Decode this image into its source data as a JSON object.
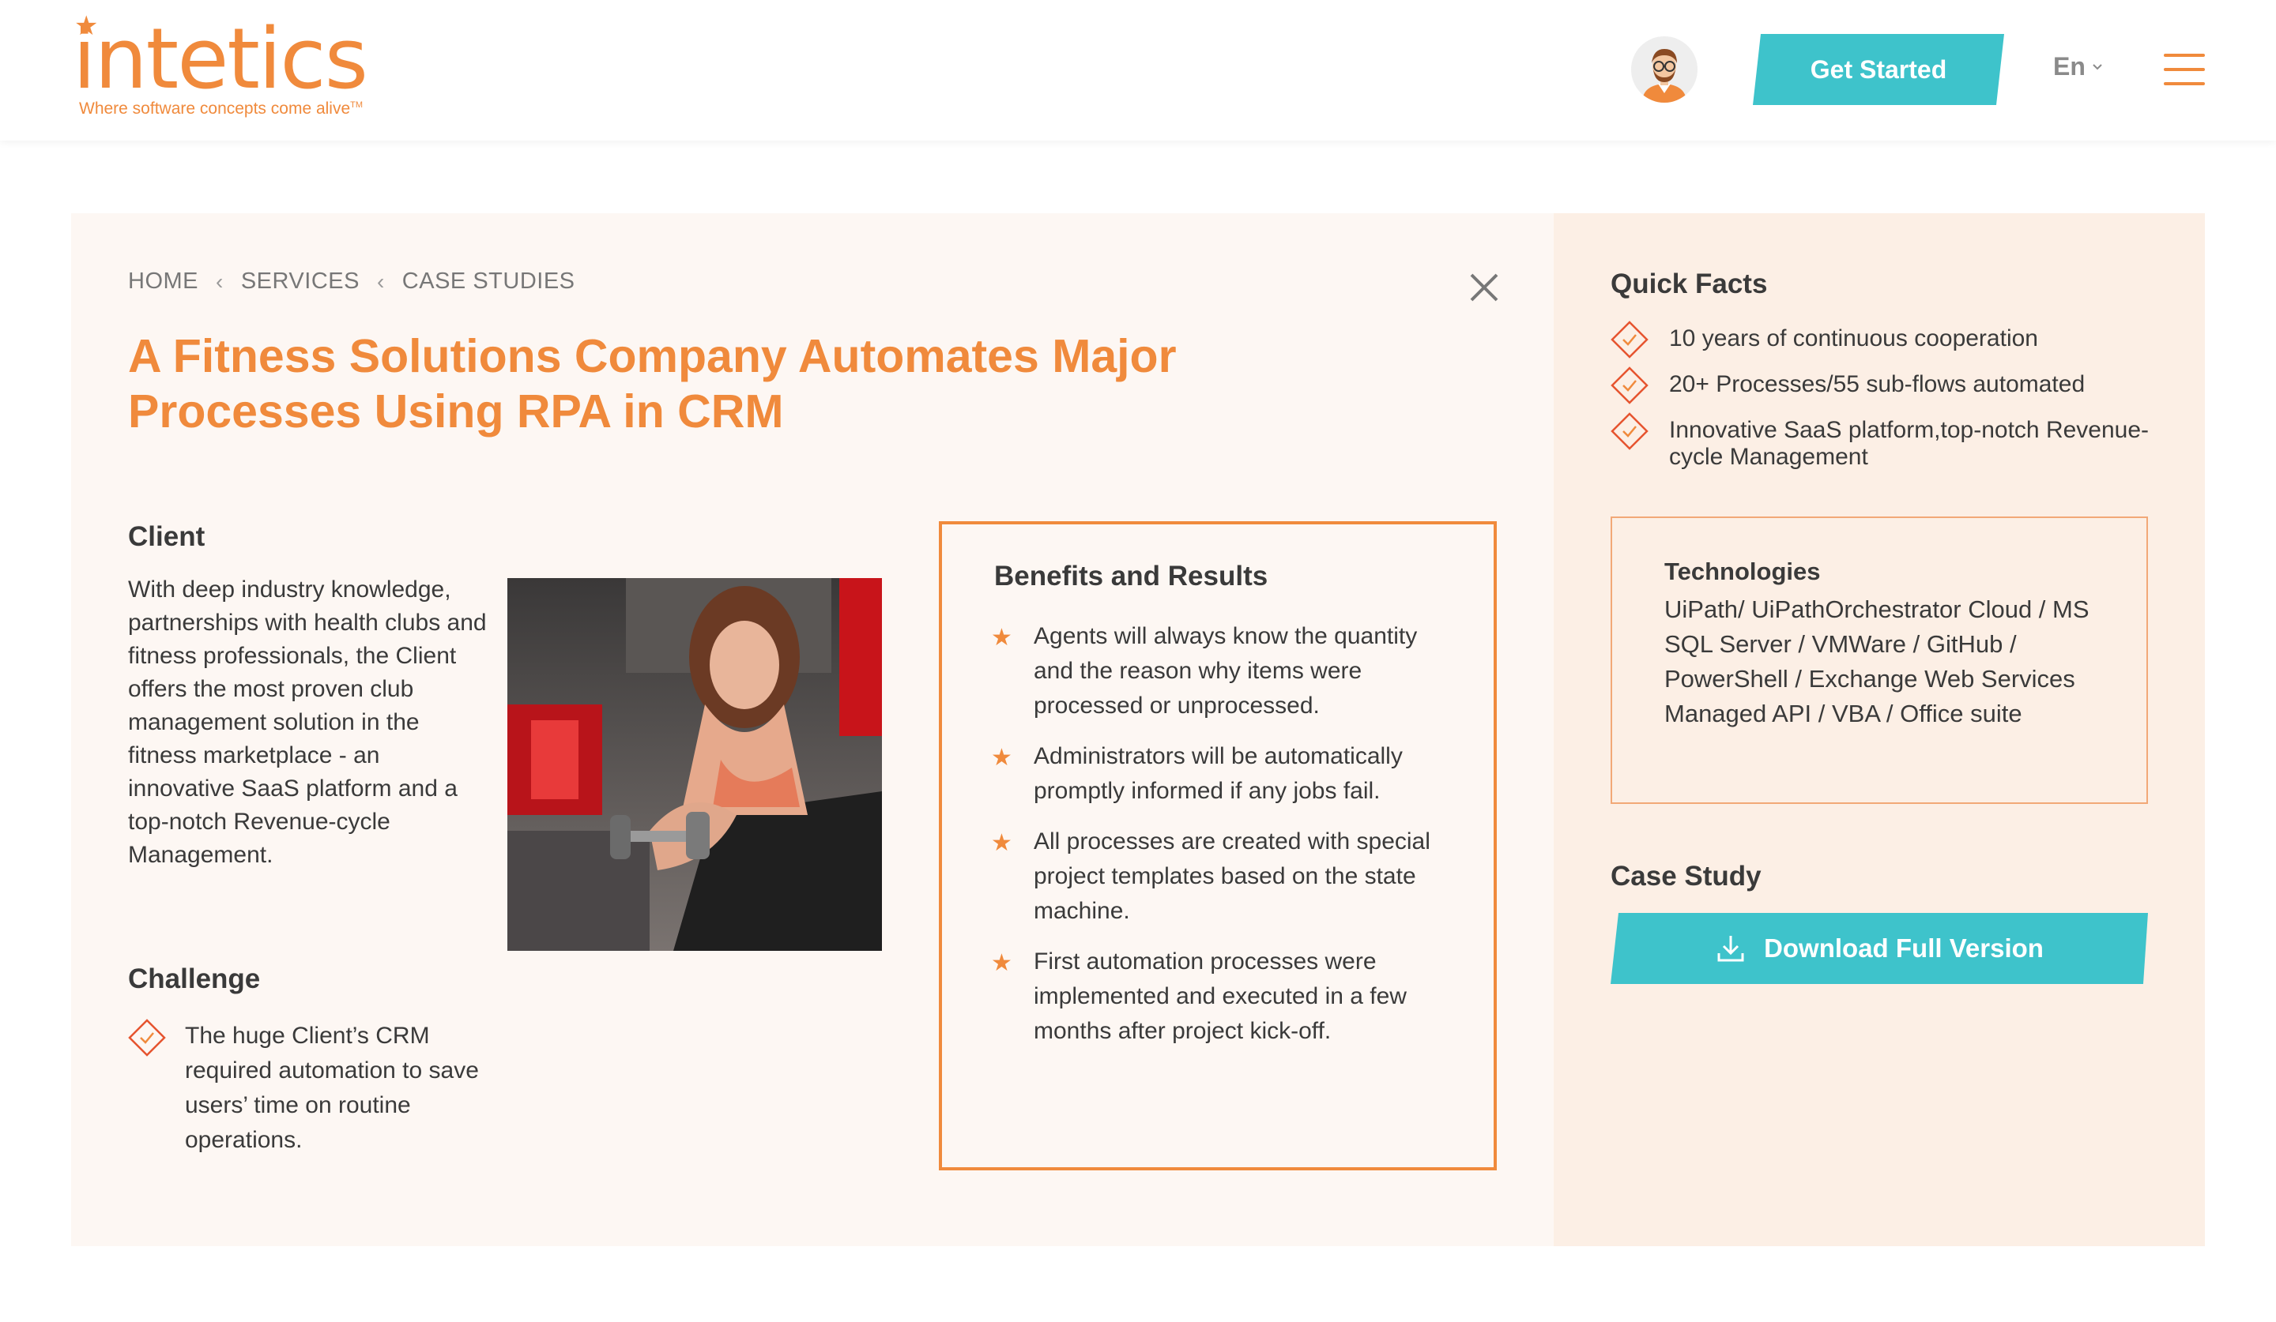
{
  "header": {
    "logo_text": "intetics",
    "logo_tagline": "Where software concepts come alive",
    "logo_tm": "TM",
    "cta_label": "Get Started",
    "lang_label": "En"
  },
  "breadcrumb": [
    "HOME",
    "SERVICES",
    "CASE STUDIES"
  ],
  "page_title": "A Fitness Solutions Company Automates Major Processes Using RPA in CRM",
  "client": {
    "heading": "Client",
    "text": "With deep industry knowledge, partnerships with health clubs and fitness professionals, the Client offers the most proven club management solution in the fitness marketplace - an innovative SaaS platform and a top-notch Revenue-cycle Management."
  },
  "challenge": {
    "heading": "Challenge",
    "items": [
      "The huge Client’s CRM required automation to save users’ time on routine operations."
    ]
  },
  "benefits": {
    "heading": "Benefits and Results",
    "items": [
      "Agents will always know the quantity and the reason why items were processed or unprocessed.",
      "Administrators will be automatically promptly informed if any jobs fail.",
      "All processes are created with special project templates based on the state machine.",
      "First automation processes were implemented and executed in a few months after project kick-off."
    ]
  },
  "quick_facts": {
    "heading": "Quick Facts",
    "items": [
      "10 years of continuous cooperation",
      "20+ Processes/55 sub-flows automated",
      "Innovative SaaS platform,top-notch Revenue-cycle Management"
    ]
  },
  "technologies": {
    "heading": "Technologies",
    "text": "UiPath/ UiPathOrchestrator Cloud / MS SQL Server / VMWare / GitHub / PowerShell / Exchange Web Services Managed API / VBA / Office suite"
  },
  "case_study": {
    "heading": "Case Study",
    "download_label": "Download Full Version"
  },
  "colors": {
    "accent": "#f08a3c",
    "button": "#3ec3cb",
    "card_bg": "#fdf7f3",
    "sidebar_bg": "#fcefe5"
  }
}
